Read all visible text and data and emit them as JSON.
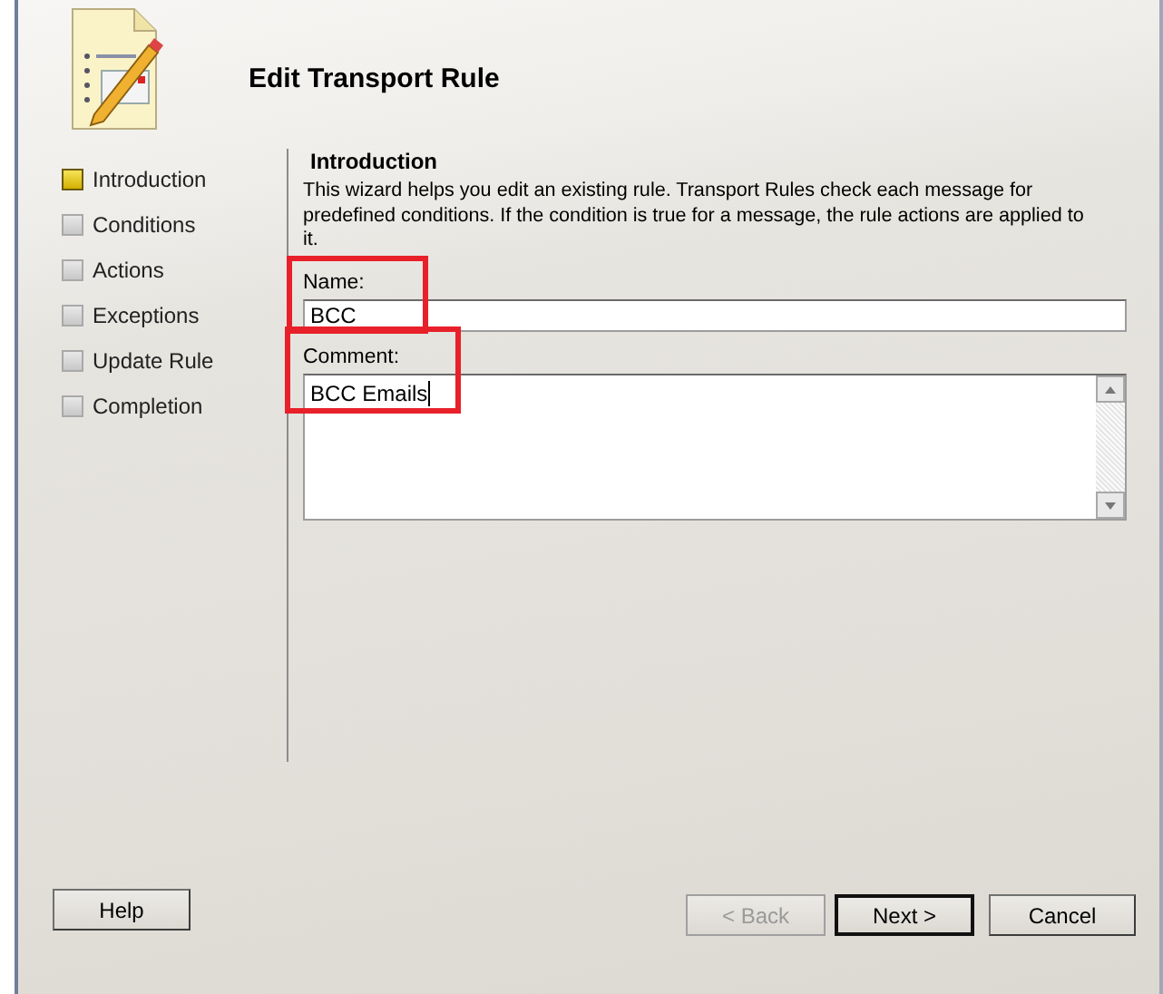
{
  "wizard": {
    "title": "Edit Transport Rule"
  },
  "steps": [
    {
      "label": "Introduction",
      "selected": true
    },
    {
      "label": "Conditions",
      "selected": false
    },
    {
      "label": "Actions",
      "selected": false
    },
    {
      "label": "Exceptions",
      "selected": false
    },
    {
      "label": "Update Rule",
      "selected": false
    },
    {
      "label": "Completion",
      "selected": false
    }
  ],
  "section": {
    "heading": "Introduction",
    "description": "This wizard helps you edit an existing rule. Transport Rules check each message for predefined conditions. If the condition is true for a message, the rule actions are applied to it."
  },
  "fields": [
    {
      "kind": "line",
      "label": "Name:",
      "value": "BCC",
      "highlighted": true,
      "focused": false
    },
    {
      "kind": "multiline",
      "label": "Comment:",
      "value": "BCC Emails",
      "highlighted": true,
      "focused": true
    }
  ],
  "help_button": {
    "label": "Help"
  },
  "buttons": [
    {
      "label": "< Back",
      "disabled": true,
      "default": false
    },
    {
      "label": "Next >",
      "disabled": false,
      "default": true
    },
    {
      "label": "Cancel",
      "disabled": false,
      "default": false
    }
  ]
}
